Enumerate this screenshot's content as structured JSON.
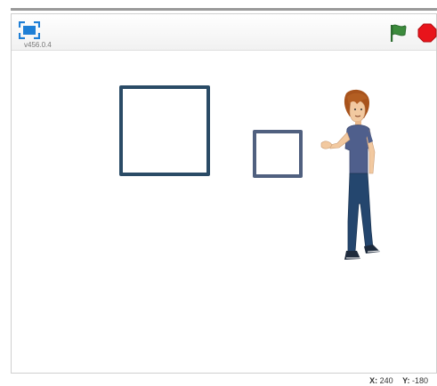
{
  "header": {
    "version": "v456.0.4",
    "fullscreen_icon": "fullscreen-icon",
    "flag_icon": "green-flag-icon",
    "stop_icon": "stop-icon"
  },
  "stage": {
    "sprites": [
      "square-outline-large",
      "square-outline-small",
      "boy-character"
    ],
    "colors": {
      "large_square": "#2a4b66",
      "small_square": "#50607f",
      "flag": "#2e7d32",
      "stop": "#e8141b"
    }
  },
  "coords": {
    "x_label": "X:",
    "x_value": "240",
    "y_label": "Y:",
    "y_value": "-180"
  }
}
